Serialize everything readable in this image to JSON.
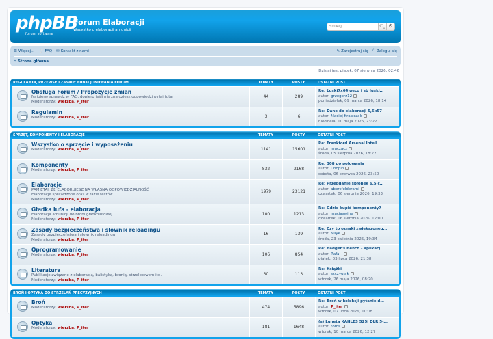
{
  "header": {
    "logo_main": "phpBB",
    "logo_sub": "forum software",
    "site_title": "Forum Elaboracji",
    "site_desc": "Wszystko o elaboracji amunicji",
    "search_placeholder": "Szukaj…"
  },
  "nav": {
    "more": "Więcej…",
    "faq": "FAQ",
    "contact": "Kontakt z nami",
    "register": "Zarejestruj się",
    "login": "Zaloguj się",
    "home": "Strona główna"
  },
  "date_text": "Dzisiaj jest piątek, 07 sierpnia 2026, 02:46",
  "col_topics": "TEMATY",
  "col_posts": "POSTY",
  "col_last": "OSTATNI POST",
  "categories": [
    {
      "name": "REGULAMIN, PRZEPISY I ZASADY FUNKCJONOWANIA FORUM",
      "forums": [
        {
          "name": "Obsługa Forum / Propozycje zmian",
          "desc": "Najpierw sprawdź w FAQ, dopiero jeśli nie znajdziesz odpowiedzi pytaj tutaj",
          "mods_label": "Moderatorzy:",
          "mods": "wierzba, P_iter",
          "topics": "44",
          "posts": "289",
          "last_title": "Re: Łuski7x64 geco i sb łuski…",
          "last_author_label": "autor:",
          "last_author": "grzegorz12",
          "last_date": "poniedziałek, 09 marca 2026, 18:14"
        },
        {
          "name": "Regulamin",
          "desc": "",
          "mods_label": "Moderatorzy:",
          "mods": "wierzba, P_iter",
          "topics": "3",
          "posts": "6",
          "last_title": "Re: Dane do elaboracji 5,6x57",
          "last_author_label": "autor:",
          "last_author": "Maciej Krawczak",
          "last_date": "niedziela, 10 maja 2026, 23:27"
        }
      ]
    },
    {
      "name": "SPRZĘT, KOMPONENTY I ELABORACJE",
      "forums": [
        {
          "name": "Wszystko o sprzęcie i wyposażeniu",
          "desc": "",
          "mods_label": "Moderatorzy:",
          "mods": "wierzba, P_iter",
          "topics": "1141",
          "posts": "15601",
          "last_title": "Re: Frankford Arsenal Intell…",
          "last_author_label": "autor:",
          "last_author": "muczacz",
          "last_date": "środa, 05 sierpnia 2026, 18:22"
        },
        {
          "name": "Komponenty",
          "desc": "",
          "mods_label": "Moderatorzy:",
          "mods": "wierzba, P_iter",
          "topics": "832",
          "posts": "9168",
          "last_title": "Re: 308 do polowania",
          "last_author_label": "autor:",
          "last_author": "Chopin",
          "last_date": "sobota, 06 czerwca 2026, 23:50"
        },
        {
          "name": "Elaboracje",
          "desc": "PAMIĘTAJ, ŻE ELABORUJESZ NA WŁASNĄ ODPOWIEDZIALNOŚĆ\nElaboracje sprawdzone oraz w fazie testów",
          "mods_label": "Moderatorzy:",
          "mods": "wierzba, P_iter",
          "topics": "1979",
          "posts": "23121",
          "last_title": "Re: Przebijanie spłonek 6.5 c…",
          "last_author_label": "autor:",
          "last_author": "abersfelderami",
          "last_date": "czwartek, 06 sierpnia 2026, 19:33"
        },
        {
          "name": "Gładka lufa - elaboracja",
          "desc": "Elaboracja amunicji do broni gładkolufowej",
          "mods_label": "Moderatorzy:",
          "mods": "wierzba, P_iter",
          "topics": "100",
          "posts": "1213",
          "last_title": "Re: Gdzie kupić komponenty?",
          "last_author_label": "autor:",
          "last_author": "maciaswine",
          "last_date": "czwartek, 06 sierpnia 2026, 12:00"
        },
        {
          "name": "Zasady bezpieczeństwa i słownik reloadingu",
          "desc": "Zasady bezpieczeństwa i słownik reloadingu",
          "mods_label": "Moderatorzy:",
          "mods": "wierzba, P_iter",
          "topics": "16",
          "posts": "139",
          "last_title": "Re: Czy to oznaki zwiększoneg…",
          "last_author_label": "autor:",
          "last_author": "Nilye",
          "last_date": "środa, 23 kwietnia 2025, 19:34"
        },
        {
          "name": "Oprogramowanie",
          "desc": "",
          "mods_label": "Moderatorzy:",
          "mods": "wierzba, P_iter",
          "topics": "106",
          "posts": "854",
          "last_title": "Re: Badger's Bench - aplikacj…",
          "last_author_label": "autor:",
          "last_author": "Rafał_",
          "last_date": "piątek, 03 lipca 2026, 21:38"
        },
        {
          "name": "Literatura",
          "desc": "Publikacje związane z elaboracją, balistyką, bronią, strzelectwem itd.",
          "mods_label": "Moderatorzy:",
          "mods": "wierzba, P_iter",
          "topics": "30",
          "posts": "113",
          "last_title": "Re: Książki",
          "last_author_label": "autor:",
          "last_author": "szczygiak",
          "last_date": "wtorek, 26 maja 2026, 08:20"
        }
      ]
    },
    {
      "name": "BROŃ I OPTYKA DO STRZELAŃ PRECYZYJNYCH",
      "forums": [
        {
          "name": "Broń",
          "desc": "",
          "mods_label": "Moderatorzy:",
          "mods": "wierzba, P_iter",
          "topics": "474",
          "posts": "5896",
          "last_title": "Re: Broń w kolekcji pytanie d…",
          "last_author_label": "autor:",
          "last_author": "P_iter",
          "last_date": "wtorek, 07 lipca 2026, 10:08"
        },
        {
          "name": "Optyka",
          "desc": "",
          "mods_label": "Moderatorzy:",
          "mods": "wierzba, P_iter",
          "topics": "181",
          "posts": "1648",
          "last_title": "(s) Luneta KAHLES 525i DLR 5-…",
          "last_author_label": "autor:",
          "last_author": "toms",
          "last_date": "wtorek, 10 marca 2026, 12:27"
        }
      ]
    }
  ]
}
